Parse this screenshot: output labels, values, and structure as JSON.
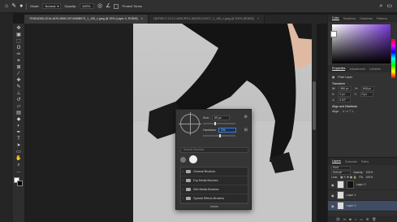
{
  "options_bar": {
    "mode_label": "Mode:",
    "mode_value": "Normal",
    "opacity_label": "Opacity:",
    "opacity_value": "100%",
    "protect_tones_label": "Protect Tones"
  },
  "tabs": [
    {
      "label": "7D9E4DE6-3216-4875-9699-2074289B073_1_105_c.jpeg @ 33% (Layer 0, RGB/8)",
      "active": true
    },
    {
      "label": "1B2F6E17-2C13-4908-9FD1-B4929C1C9C7_1_105_c.jpeg @ 100% (RGB/8)",
      "active": false
    }
  ],
  "toolbar": {
    "tools": [
      "move",
      "artboard",
      "marquee",
      "lasso",
      "quick-select",
      "crop",
      "frame",
      "eyedropper",
      "heal",
      "brush",
      "stamp",
      "history",
      "eraser",
      "gradient",
      "blur",
      "dodge",
      "pen",
      "type",
      "path-select",
      "shape",
      "hand",
      "zoom",
      "more"
    ]
  },
  "brush_panel": {
    "size_label": "Size:",
    "size_value": "65 px",
    "hardness_label": "Hardness:",
    "hardness_value": "0%",
    "search_placeholder": "Search Brushes",
    "folders": [
      "General Brushes",
      "Dry Media Brushes",
      "Wet Media Brushes",
      "Special Effects Brushes"
    ]
  },
  "right_panel": {
    "color_tabs": [
      "Color",
      "Swatches",
      "Gradients",
      "Patterns"
    ],
    "props_tabs": [
      "Properties",
      "Adjustments",
      "Libraries"
    ],
    "pixel_layer": "Pixel Layer",
    "transform_title": "Transform",
    "transform": {
      "w": "W:",
      "w_val": "566 px",
      "h": "H:",
      "h_val": "848 px",
      "x": "X:",
      "x_val": "0 px",
      "y": "Y:",
      "y_val": "0 px",
      "angle": "0.00°"
    },
    "align_title": "Align and Distribute",
    "align_sub": "Align:",
    "layers_tabs": [
      "Layers",
      "Channels",
      "Paths"
    ],
    "kind": "Kind",
    "blend": "Normal",
    "opacity_label": "Opacity:",
    "opacity_value": "100%",
    "lock_label": "Lock:",
    "fill_label": "Fill:",
    "fill_value": "100%",
    "layers": [
      {
        "name": "Layer 2",
        "selected": false,
        "mask": true
      },
      {
        "name": "Layer 1",
        "selected": false,
        "mask": false
      },
      {
        "name": "Layer 0",
        "selected": true,
        "mask": false
      }
    ]
  },
  "colors": {
    "accent": "#3d7bd9",
    "canvas_bg": "#c9c9c9",
    "pants": "#141414"
  }
}
